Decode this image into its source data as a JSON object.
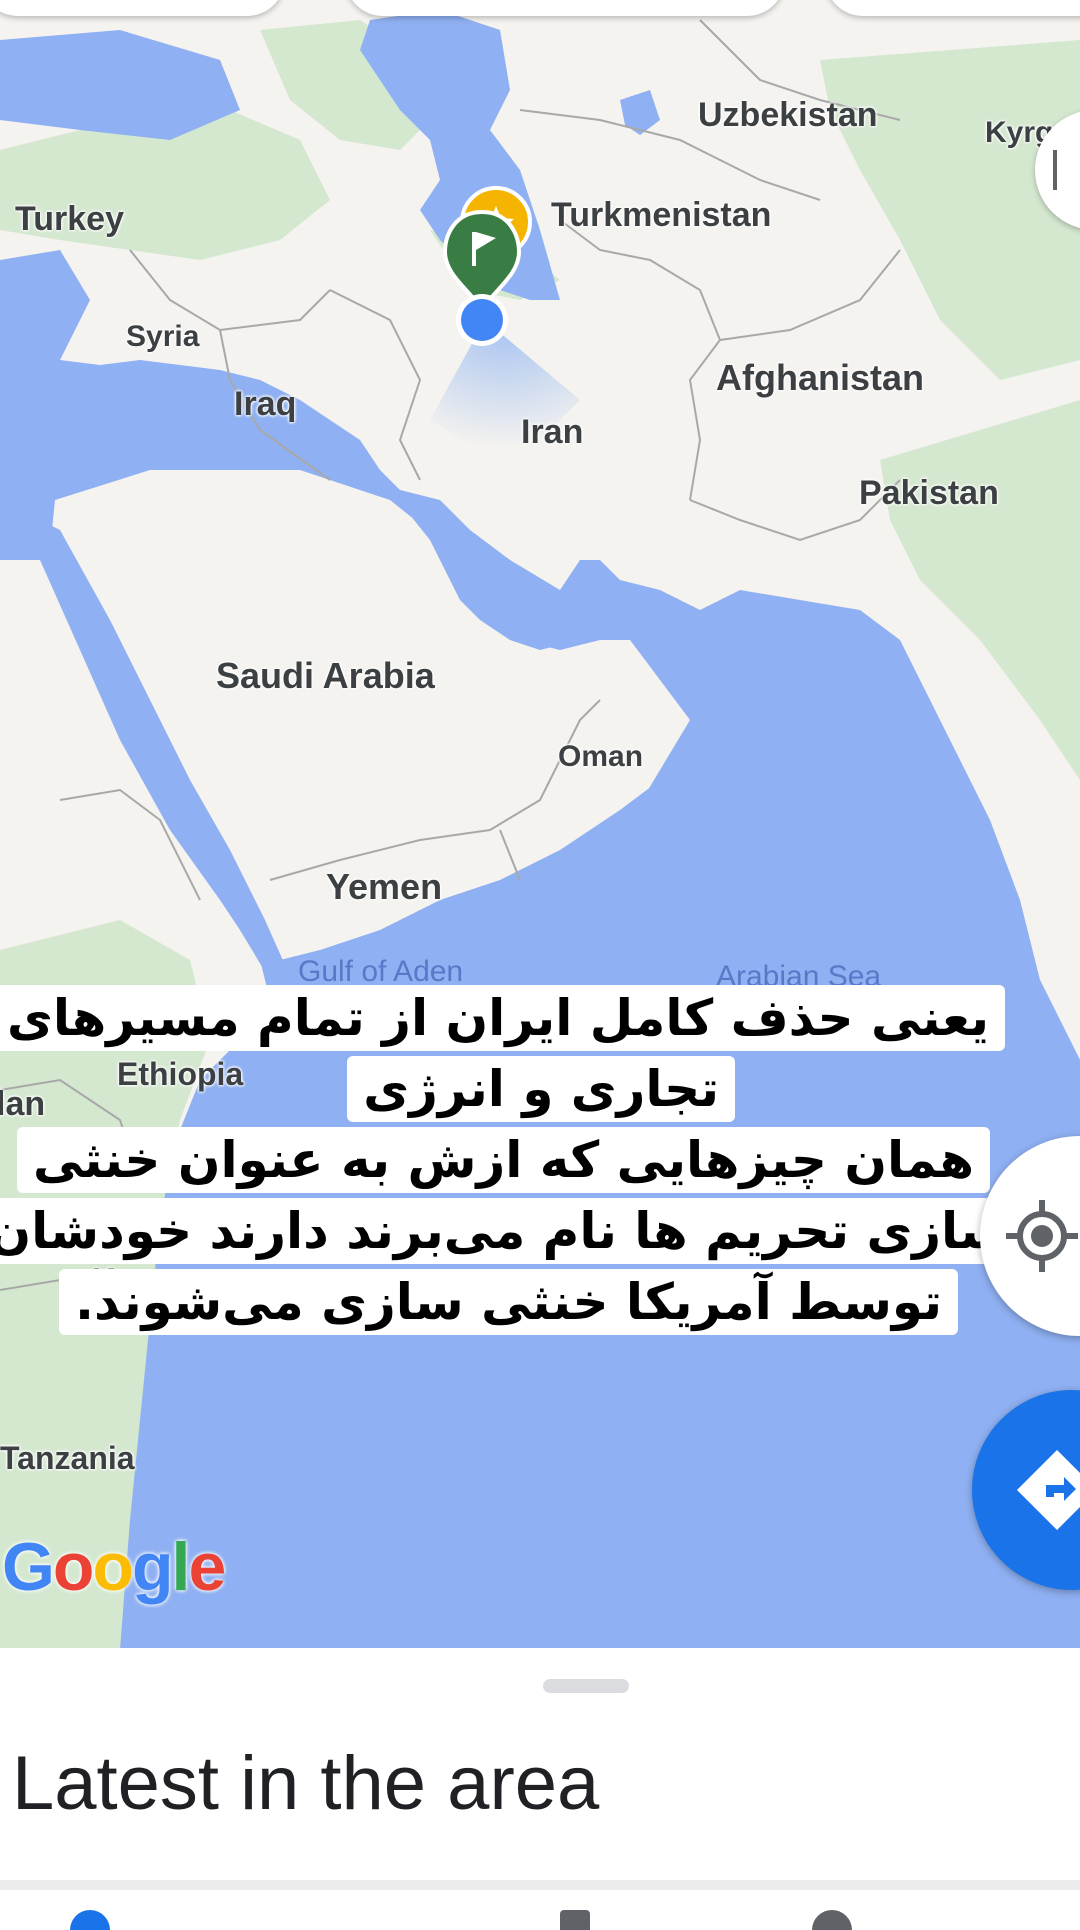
{
  "map": {
    "countries": [
      {
        "key": "uzbekistan",
        "label": "Uzbekistan"
      },
      {
        "key": "kyrgyzstan",
        "label": "Kyrg"
      },
      {
        "key": "turkey",
        "label": "Turkey"
      },
      {
        "key": "turkmenistan",
        "label": "Turkmenistan"
      },
      {
        "key": "syria",
        "label": "Syria"
      },
      {
        "key": "iraq",
        "label": "Iraq"
      },
      {
        "key": "afghanistan",
        "label": "Afghanistan"
      },
      {
        "key": "iran",
        "label": "Iran"
      },
      {
        "key": "pakistan",
        "label": "Pakistan"
      },
      {
        "key": "saudi_arabia",
        "label": "Saudi Arabia"
      },
      {
        "key": "oman",
        "label": "Oman"
      },
      {
        "key": "yemen",
        "label": "Yemen"
      },
      {
        "key": "ethiopia",
        "label": "Ethiopia"
      },
      {
        "key": "sudan_partial",
        "label": "lan"
      },
      {
        "key": "kenya_partial",
        "label": "Ke"
      },
      {
        "key": "tanzania",
        "label": "Tanzania"
      }
    ],
    "seas": [
      {
        "key": "gulf_of_aden",
        "label": "Gulf of Aden"
      },
      {
        "key": "arabian_sea",
        "label": "Arabian Sea"
      }
    ],
    "markers": {
      "destination_icon": "flag-icon",
      "saved_place_icon": "star-icon",
      "current_location": "blue-dot"
    },
    "colors": {
      "water": "#8fb0f2",
      "land": "#f5f3ef",
      "vegetation": "#d4e7cf",
      "marker_green": "#3a7d44",
      "marker_yellow": "#f4b400",
      "location_blue": "#4285f4"
    }
  },
  "overlay_text": {
    "line1": "یعنی حذف کامل ایران از تمام مسیرهای",
    "line2": "تجاری و انرژی",
    "line3": "همان چیزهایی که ازش به عنوان خنثی",
    "line4": "سازی تحریم ها نام می‌برند دارند خودشان",
    "line5": "توسط آمریکا خنثی سازی می‌شوند."
  },
  "logo": {
    "letters": [
      "G",
      "o",
      "o",
      "g",
      "l",
      "e"
    ],
    "colors": [
      "#4285f4",
      "#ea4335",
      "#fbbc05",
      "#4285f4",
      "#34a853",
      "#ea4335"
    ]
  },
  "controls": {
    "locate_icon": "my-location-icon",
    "directions_icon": "directions-icon",
    "side_icon": "layers-icon"
  },
  "sheet": {
    "title": "Latest in the area"
  }
}
